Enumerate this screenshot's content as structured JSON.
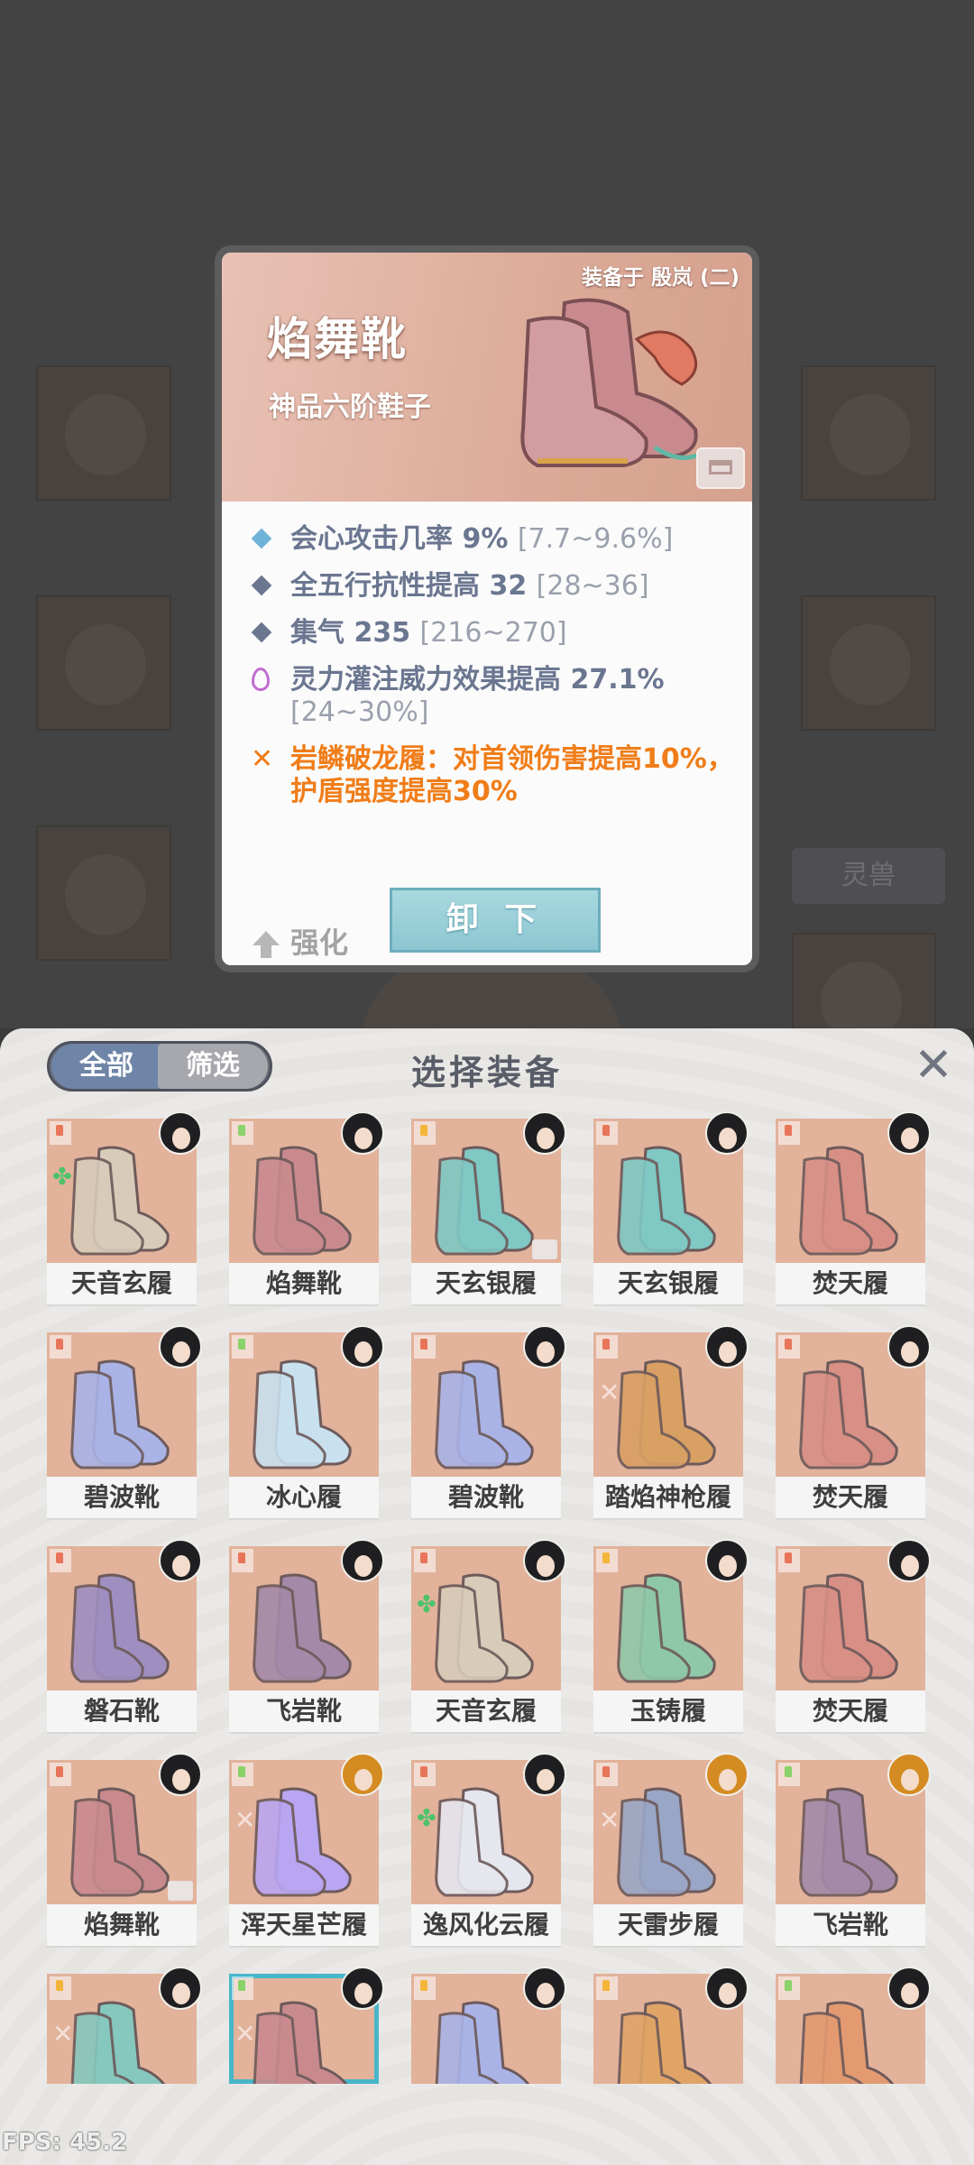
{
  "background": {
    "side_tag": "灵兽"
  },
  "detail": {
    "equipped_on": "装备于 殷岚 (二)",
    "name": "焰舞靴",
    "grade": "神品六阶鞋子",
    "stats": [
      {
        "text": "会心攻击几率 9%",
        "range": "[7.7~9.6%]",
        "marker": "diamond",
        "color": "#6fb3d8"
      },
      {
        "text": "全五行抗性提高 32",
        "range": "[28~36]",
        "marker": "diamond",
        "color": "#6b7690"
      },
      {
        "text": "集气 235",
        "range": "[216~270]",
        "marker": "diamond",
        "color": "#6b7690"
      },
      {
        "text": "灵力灌注威力效果提高 27.1%",
        "range": "[24~30%]",
        "marker": "flame",
        "color": "#c06dd0"
      }
    ],
    "special": "岩鳞破龙履：对首领伤害提高10%，护盾强度提高30%",
    "strengthen_label": "强化",
    "unequip_label": "卸 下"
  },
  "panel": {
    "title": "选择装备",
    "filter_all": "全部",
    "filter_screen": "筛选",
    "close_icon": "close-icon"
  },
  "items": [
    {
      "name": "天音玄履",
      "pos": "r",
      "boot": "#d7cbb9",
      "mark": "clover"
    },
    {
      "name": "焰舞靴",
      "pos": "g",
      "boot": "#c98a8e",
      "mark": ""
    },
    {
      "name": "天玄银履",
      "pos": "y",
      "boot": "#7fc8c4",
      "mark": "",
      "lock": true
    },
    {
      "name": "天玄银履",
      "pos": "r",
      "boot": "#7fc8c4",
      "mark": ""
    },
    {
      "name": "焚天履",
      "pos": "r",
      "boot": "#d78f86",
      "mark": ""
    },
    {
      "name": "碧波靴",
      "pos": "r",
      "boot": "#a9b3e6",
      "mark": ""
    },
    {
      "name": "冰心履",
      "pos": "g",
      "boot": "#c9e0ee",
      "mark": ""
    },
    {
      "name": "碧波靴",
      "pos": "r",
      "boot": "#a9b3e6",
      "mark": ""
    },
    {
      "name": "踏焰神枪履",
      "pos": "r",
      "boot": "#d9a064",
      "mark": "x"
    },
    {
      "name": "焚天履",
      "pos": "r",
      "boot": "#d78f86",
      "mark": ""
    },
    {
      "name": "磐石靴",
      "pos": "r",
      "boot": "#9f8fc0",
      "mark": ""
    },
    {
      "name": "飞岩靴",
      "pos": "r",
      "boot": "#a48aa8",
      "mark": ""
    },
    {
      "name": "天音玄履",
      "pos": "r",
      "boot": "#d7cbb9",
      "mark": "clover"
    },
    {
      "name": "玉铸履",
      "pos": "y",
      "boot": "#8fc8a8",
      "mark": ""
    },
    {
      "name": "焚天履",
      "pos": "r",
      "boot": "#d78f86",
      "mark": ""
    },
    {
      "name": "焰舞靴",
      "pos": "r",
      "boot": "#c98a8e",
      "mark": "",
      "lock": true
    },
    {
      "name": "浑天星芒履",
      "pos": "g",
      "boot": "#b9a6f2",
      "mark": "x"
    },
    {
      "name": "逸风化云履",
      "pos": "r",
      "boot": "#e6e6ee",
      "mark": "clover"
    },
    {
      "name": "天雷步履",
      "pos": "r",
      "boot": "#9aa6c6",
      "mark": "x"
    },
    {
      "name": "飞岩靴",
      "pos": "g",
      "boot": "#a48aa8",
      "mark": ""
    },
    {
      "name": "",
      "pos": "y",
      "boot": "#86c8bd",
      "mark": "x"
    },
    {
      "name": "",
      "pos": "g",
      "boot": "#c98a8e",
      "mark": "x",
      "selected": true
    },
    {
      "name": "",
      "pos": "y",
      "boot": "#a9b3e6",
      "mark": ""
    },
    {
      "name": "",
      "pos": "y",
      "boot": "#e0a467",
      "mark": ""
    },
    {
      "name": "",
      "pos": "g",
      "boot": "#e39a70",
      "mark": ""
    }
  ],
  "fps": "FPS: 45.2"
}
